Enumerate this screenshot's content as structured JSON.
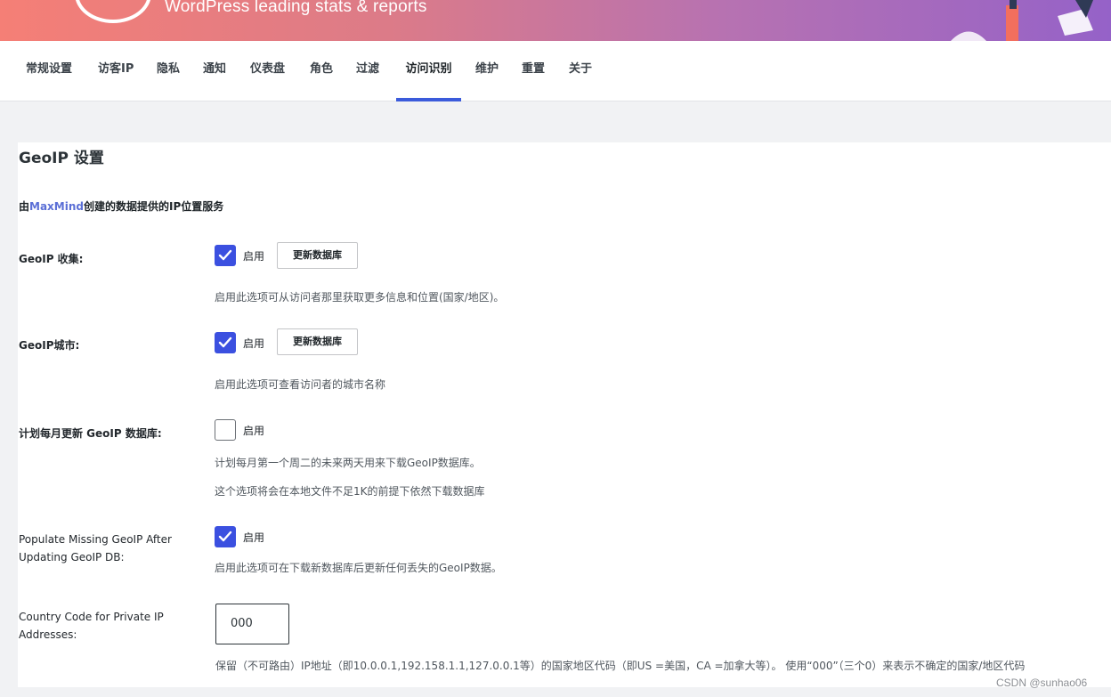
{
  "banner": {
    "tagline": "WordPress leading stats & reports"
  },
  "tabs": [
    {
      "label": "常规设置",
      "active": false
    },
    {
      "label": "访客IP",
      "active": false
    },
    {
      "label": "隐私",
      "active": false
    },
    {
      "label": "通知",
      "active": false
    },
    {
      "label": "仪表盘",
      "active": false
    },
    {
      "label": "角色",
      "active": false
    },
    {
      "label": "过滤",
      "active": false
    },
    {
      "label": "访问识别",
      "active": true
    },
    {
      "label": "维护",
      "active": false
    },
    {
      "label": "重置",
      "active": false
    },
    {
      "label": "关于",
      "active": false
    }
  ],
  "panel": {
    "title": "GeoIP 设置",
    "intro_prefix": "由",
    "intro_link": "MaxMind",
    "intro_suffix": "创建的数据提供的IP位置服务",
    "settings": [
      {
        "label": "GeoIP 收集:",
        "checked": true,
        "checkbox_label": "启用",
        "button": "更新数据库",
        "desc": [
          "启用此选项可从访问者那里获取更多信息和位置(国家/地区)。"
        ]
      },
      {
        "label": "GeoIP城市:",
        "checked": true,
        "checkbox_label": "启用",
        "button": "更新数据库",
        "desc": [
          "启用此选项可查看访问者的城市名称"
        ]
      },
      {
        "label": "计划每月更新 GeoIP 数据库:",
        "checked": false,
        "checkbox_label": "启用",
        "desc": [
          "计划每月第一个周二的未来两天用来下载GeoIP数据库。",
          "这个选项将会在本地文件不足1K的前提下依然下载数据库"
        ]
      },
      {
        "label": "Populate Missing GeoIP After Updating GeoIP DB:",
        "checked": true,
        "checkbox_label": "启用",
        "desc": [
          "启用此选项可在下载新数据库后更新任何丢失的GeoIP数据。"
        ]
      },
      {
        "label": "Country Code for Private IP Addresses:",
        "input_value": "000",
        "desc": [
          "保留（不可路由）IP地址（即10.0.0.1,192.158.1.1,127.0.0.1等）的国家地区代码（即US =美国，CA =加拿大等）。 使用“000”（三个0）来表示不确定的国家/地区代码"
        ]
      }
    ]
  },
  "watermark": "CSDN @sunhao06",
  "colors": {
    "accent": "#3b50e0",
    "link": "#5b6fd6",
    "banner_start": "#f57f76",
    "banner_end": "#9562c8"
  }
}
